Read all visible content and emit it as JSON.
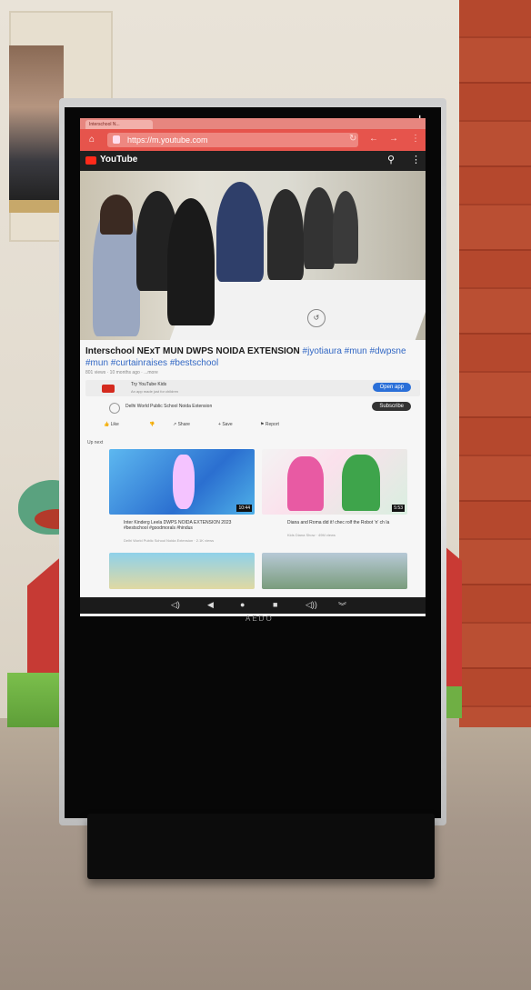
{
  "browser": {
    "tab_label": "Interschool N...",
    "url": "https://m.youtube.com"
  },
  "youtube": {
    "brand": "YouTube",
    "video": {
      "title": "Interschool NExT MUN DWPS NOIDA EXTENSION",
      "hashtags": "#jyotiaura #mun #dwpsne #mun #curtainraises #bestschool",
      "meta": "801 views · 10 months ago · ...more"
    },
    "promo": {
      "title": "Try YouTube Kids",
      "subtitle": "An app made just for children",
      "button": "Open app"
    },
    "channel": {
      "name": "Delhi World Public School Noida Extension",
      "subscribe": "Subscribe"
    },
    "actions": [
      "Like",
      "Dislike",
      "Share",
      "Save",
      "Report"
    ],
    "up_next_label": "Up next",
    "recommendations": [
      {
        "duration": "10:44",
        "title": "Inter Kinderg Leela DWPS NOIDA EXTENSION 2023 #bestschool #goodmorals #hindus",
        "channel": "Delhi World Public School Noida Extension · 2.1K views"
      },
      {
        "duration": "5:53",
        "title": "Diana and Roma did it! chec rolf the Robot 'n' ch la",
        "channel": "Kids Diana Show · 49M views"
      }
    ]
  },
  "device": {
    "brand": "AEDO"
  },
  "colors": {
    "browser_chrome": "#e6544c",
    "youtube_red": "#ff2a1a",
    "link_blue": "#3368c4",
    "open_app_blue": "#2a6fd8"
  },
  "icons": [
    "home-icon",
    "lock-icon",
    "reload-icon",
    "back-icon",
    "forward-icon",
    "menu-icon",
    "search-icon",
    "more-icon",
    "volume-down-icon",
    "back-nav-icon",
    "home-nav-icon",
    "recents-nav-icon",
    "volume-up-icon",
    "collapse-icon"
  ]
}
